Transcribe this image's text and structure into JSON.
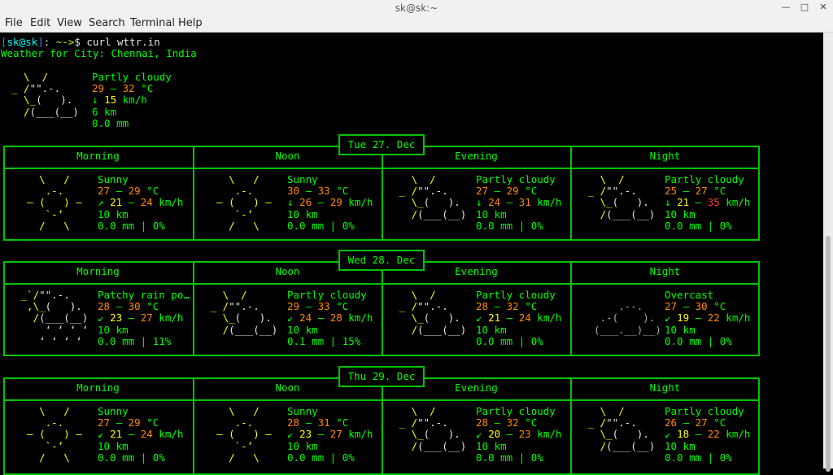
{
  "window": {
    "title": "sk@sk:~"
  },
  "menu": [
    "File",
    "Edit",
    "View",
    "Search",
    "Terminal",
    "Help"
  ],
  "prompt": {
    "user": "sk@sk",
    "path": "~",
    "command": "curl wttr.in"
  },
  "location": "Weather for City: Chennai, India",
  "current": {
    "condition": "Partly cloudy",
    "temp_lo": "29",
    "temp_hi": "32",
    "unit": "°C",
    "wind_dir": "↓",
    "wind": "15",
    "wind_unit": "km/h",
    "visibility": "6 km",
    "rain": "0.0 mm"
  },
  "periods": [
    "Morning",
    "Noon",
    "Evening",
    "Night"
  ],
  "days": [
    {
      "label": "Tue 27. Dec",
      "slots": [
        {
          "icon": "sunny",
          "cond": "Sunny",
          "t1": "27",
          "t2": "29",
          "dir": "↗",
          "w1": "21",
          "w2": "24",
          "vis": "10 km",
          "rain": "0.0 mm | 0%"
        },
        {
          "icon": "sunny",
          "cond": "Sunny",
          "t1": "30",
          "t2": "33",
          "dir": "↓",
          "w1": "26",
          "w2": "29",
          "vis": "10 km",
          "rain": "0.0 mm | 0%"
        },
        {
          "icon": "partly",
          "cond": "Partly cloudy",
          "t1": "27",
          "t2": "29",
          "dir": "↓",
          "w1": "24",
          "w2": "31",
          "vis": "10 km",
          "rain": "0.0 mm | 0%"
        },
        {
          "icon": "partly",
          "cond": "Partly cloudy",
          "t1": "25",
          "t2": "27",
          "dir": "↓",
          "w1": "21",
          "w2": "35",
          "vis": "10 km",
          "rain": "0.0 mm | 0%"
        }
      ]
    },
    {
      "label": "Wed 28. Dec",
      "slots": [
        {
          "icon": "rain",
          "cond": "Patchy rain po…",
          "t1": "28",
          "t2": "30",
          "dir": "↙",
          "w1": "23",
          "w2": "27",
          "vis": "10 km",
          "rain": "0.0 mm | 11%"
        },
        {
          "icon": "partly",
          "cond": "Partly cloudy",
          "t1": "29",
          "t2": "33",
          "dir": "↙",
          "w1": "24",
          "w2": "28",
          "vis": "10 km",
          "rain": "0.1 mm | 15%"
        },
        {
          "icon": "partly",
          "cond": "Partly cloudy",
          "t1": "28",
          "t2": "32",
          "dir": "↙",
          "w1": "21",
          "w2": "24",
          "vis": "10 km",
          "rain": "0.0 mm | 0%"
        },
        {
          "icon": "overcast",
          "cond": "Overcast",
          "t1": "27",
          "t2": "30",
          "dir": "↙",
          "w1": "19",
          "w2": "22",
          "vis": "10 km",
          "rain": "0.0 mm | 0%"
        }
      ]
    },
    {
      "label": "Thu 29. Dec",
      "slots": [
        {
          "icon": "sunny",
          "cond": "Sunny",
          "t1": "27",
          "t2": "29",
          "dir": "↙",
          "w1": "21",
          "w2": "24",
          "vis": "10 km",
          "rain": "0.0 mm | 0%"
        },
        {
          "icon": "sunny",
          "cond": "Sunny",
          "t1": "28",
          "t2": "31",
          "dir": "↙",
          "w1": "23",
          "w2": "27",
          "vis": "10 km",
          "rain": "0.0 mm | 0%"
        },
        {
          "icon": "partly",
          "cond": "Partly cloudy",
          "t1": "28",
          "t2": "32",
          "dir": "↙",
          "w1": "20",
          "w2": "23",
          "vis": "10 km",
          "rain": "0.0 mm | 0%"
        },
        {
          "icon": "partly",
          "cond": "Partly cloudy",
          "t1": "26",
          "t2": "27",
          "dir": "↙",
          "w1": "18",
          "w2": "22",
          "vis": "10 km",
          "rain": "0.0 mm | 0%"
        }
      ]
    }
  ],
  "colors": {
    "terminal_bg": "#000000",
    "text": "#00ff00",
    "border": "#00c400",
    "sun": "#ffff00",
    "temp": "#ff8800",
    "wind_high": "#ff3b3b"
  }
}
